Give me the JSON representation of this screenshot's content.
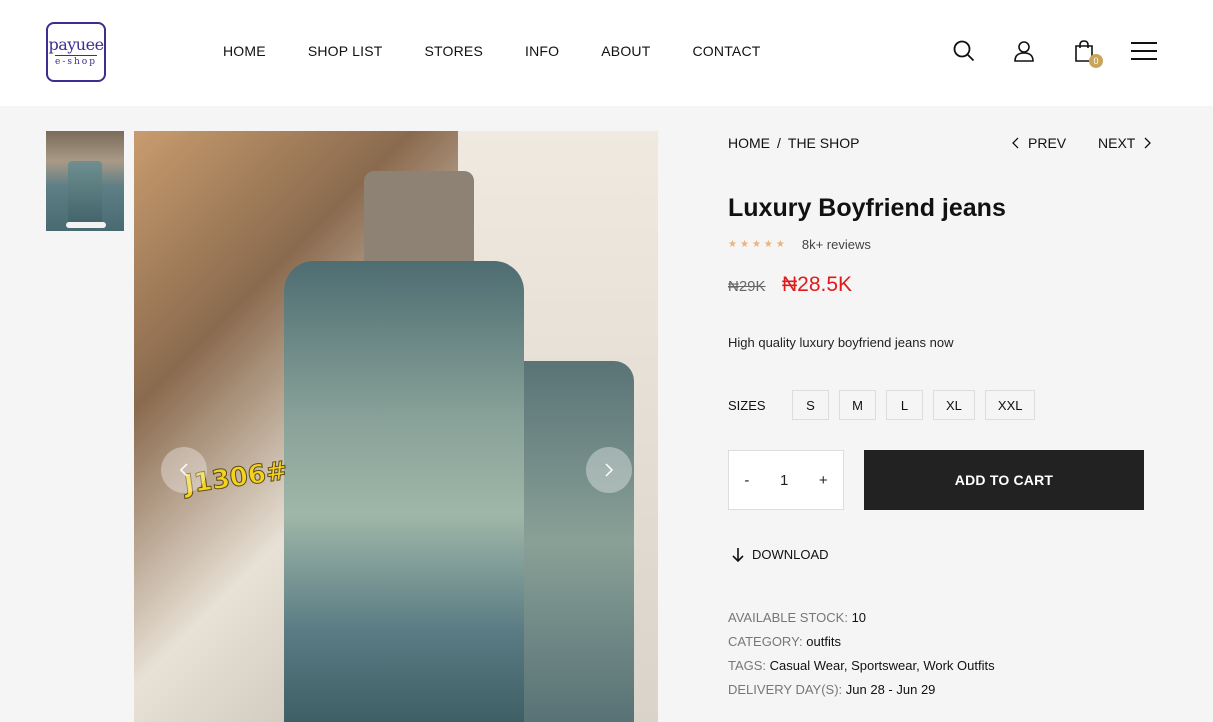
{
  "brand": {
    "line1": "payuee",
    "line2": "e-shop"
  },
  "nav": [
    "HOME",
    "SHOP LIST",
    "STORES",
    "INFO",
    "ABOUT",
    "CONTACT"
  ],
  "header_icons": [
    "search-icon",
    "user-icon",
    "cart-icon",
    "menu-icon"
  ],
  "cart_count": "0",
  "breadcrumb": {
    "home": "HOME",
    "sep": "/",
    "current": "THE SHOP"
  },
  "pager": {
    "prev": "PREV",
    "next": "NEXT"
  },
  "product": {
    "title": "Luxury Boyfriend jeans",
    "rating_stars": 5,
    "reviews": "8k+ reviews",
    "old_price": "₦29K",
    "price": "₦28.5K",
    "description": "High quality luxury boyfriend jeans now",
    "image_tag": "J1306#"
  },
  "sizes": {
    "label": "SIZES",
    "options": [
      "S",
      "M",
      "L",
      "XL",
      "XXL"
    ]
  },
  "quantity": {
    "minus": "-",
    "value": "1",
    "plus": "+"
  },
  "add_to_cart": "ADD TO CART",
  "download": "DOWNLOAD",
  "meta": {
    "stock_label": "AVAILABLE STOCK:",
    "stock": "10",
    "category_label": "CATEGORY:",
    "category": "outfits",
    "tags_label": "TAGS:",
    "tags": "Casual Wear, Sportswear, Work Outfits",
    "delivery_label": "DELIVERY DAY(S):",
    "delivery": "Jun 28 - Jun 29"
  },
  "colors": {
    "price_red": "#e01b1b",
    "badge": "#c9a55c",
    "button": "#222222",
    "brand": "#3a2f8f"
  }
}
